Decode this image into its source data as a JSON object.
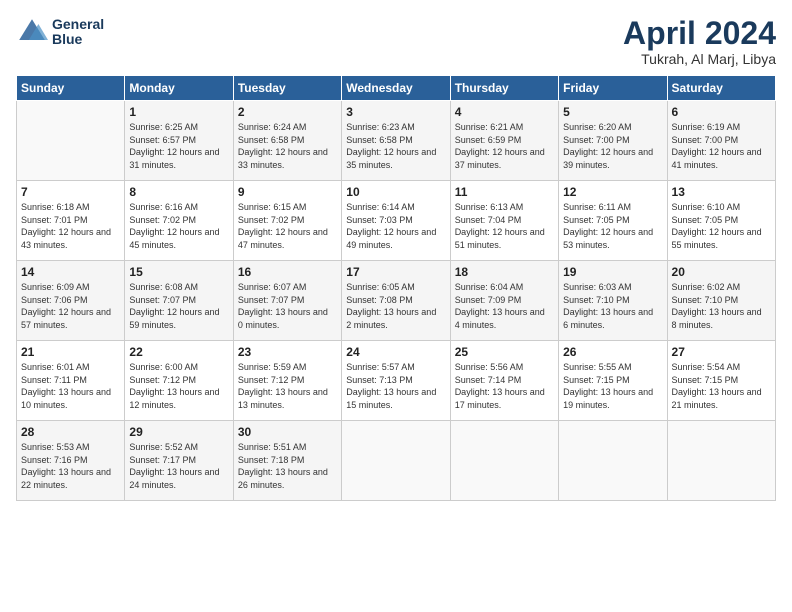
{
  "header": {
    "logo_line1": "General",
    "logo_line2": "Blue",
    "title": "April 2024",
    "location": "Tukrah, Al Marj, Libya"
  },
  "weekdays": [
    "Sunday",
    "Monday",
    "Tuesday",
    "Wednesday",
    "Thursday",
    "Friday",
    "Saturday"
  ],
  "weeks": [
    [
      {
        "day": "",
        "sunrise": "",
        "sunset": "",
        "daylight": ""
      },
      {
        "day": "1",
        "sunrise": "Sunrise: 6:25 AM",
        "sunset": "Sunset: 6:57 PM",
        "daylight": "Daylight: 12 hours and 31 minutes."
      },
      {
        "day": "2",
        "sunrise": "Sunrise: 6:24 AM",
        "sunset": "Sunset: 6:58 PM",
        "daylight": "Daylight: 12 hours and 33 minutes."
      },
      {
        "day": "3",
        "sunrise": "Sunrise: 6:23 AM",
        "sunset": "Sunset: 6:58 PM",
        "daylight": "Daylight: 12 hours and 35 minutes."
      },
      {
        "day": "4",
        "sunrise": "Sunrise: 6:21 AM",
        "sunset": "Sunset: 6:59 PM",
        "daylight": "Daylight: 12 hours and 37 minutes."
      },
      {
        "day": "5",
        "sunrise": "Sunrise: 6:20 AM",
        "sunset": "Sunset: 7:00 PM",
        "daylight": "Daylight: 12 hours and 39 minutes."
      },
      {
        "day": "6",
        "sunrise": "Sunrise: 6:19 AM",
        "sunset": "Sunset: 7:00 PM",
        "daylight": "Daylight: 12 hours and 41 minutes."
      }
    ],
    [
      {
        "day": "7",
        "sunrise": "Sunrise: 6:18 AM",
        "sunset": "Sunset: 7:01 PM",
        "daylight": "Daylight: 12 hours and 43 minutes."
      },
      {
        "day": "8",
        "sunrise": "Sunrise: 6:16 AM",
        "sunset": "Sunset: 7:02 PM",
        "daylight": "Daylight: 12 hours and 45 minutes."
      },
      {
        "day": "9",
        "sunrise": "Sunrise: 6:15 AM",
        "sunset": "Sunset: 7:02 PM",
        "daylight": "Daylight: 12 hours and 47 minutes."
      },
      {
        "day": "10",
        "sunrise": "Sunrise: 6:14 AM",
        "sunset": "Sunset: 7:03 PM",
        "daylight": "Daylight: 12 hours and 49 minutes."
      },
      {
        "day": "11",
        "sunrise": "Sunrise: 6:13 AM",
        "sunset": "Sunset: 7:04 PM",
        "daylight": "Daylight: 12 hours and 51 minutes."
      },
      {
        "day": "12",
        "sunrise": "Sunrise: 6:11 AM",
        "sunset": "Sunset: 7:05 PM",
        "daylight": "Daylight: 12 hours and 53 minutes."
      },
      {
        "day": "13",
        "sunrise": "Sunrise: 6:10 AM",
        "sunset": "Sunset: 7:05 PM",
        "daylight": "Daylight: 12 hours and 55 minutes."
      }
    ],
    [
      {
        "day": "14",
        "sunrise": "Sunrise: 6:09 AM",
        "sunset": "Sunset: 7:06 PM",
        "daylight": "Daylight: 12 hours and 57 minutes."
      },
      {
        "day": "15",
        "sunrise": "Sunrise: 6:08 AM",
        "sunset": "Sunset: 7:07 PM",
        "daylight": "Daylight: 12 hours and 59 minutes."
      },
      {
        "day": "16",
        "sunrise": "Sunrise: 6:07 AM",
        "sunset": "Sunset: 7:07 PM",
        "daylight": "Daylight: 13 hours and 0 minutes."
      },
      {
        "day": "17",
        "sunrise": "Sunrise: 6:05 AM",
        "sunset": "Sunset: 7:08 PM",
        "daylight": "Daylight: 13 hours and 2 minutes."
      },
      {
        "day": "18",
        "sunrise": "Sunrise: 6:04 AM",
        "sunset": "Sunset: 7:09 PM",
        "daylight": "Daylight: 13 hours and 4 minutes."
      },
      {
        "day": "19",
        "sunrise": "Sunrise: 6:03 AM",
        "sunset": "Sunset: 7:10 PM",
        "daylight": "Daylight: 13 hours and 6 minutes."
      },
      {
        "day": "20",
        "sunrise": "Sunrise: 6:02 AM",
        "sunset": "Sunset: 7:10 PM",
        "daylight": "Daylight: 13 hours and 8 minutes."
      }
    ],
    [
      {
        "day": "21",
        "sunrise": "Sunrise: 6:01 AM",
        "sunset": "Sunset: 7:11 PM",
        "daylight": "Daylight: 13 hours and 10 minutes."
      },
      {
        "day": "22",
        "sunrise": "Sunrise: 6:00 AM",
        "sunset": "Sunset: 7:12 PM",
        "daylight": "Daylight: 13 hours and 12 minutes."
      },
      {
        "day": "23",
        "sunrise": "Sunrise: 5:59 AM",
        "sunset": "Sunset: 7:12 PM",
        "daylight": "Daylight: 13 hours and 13 minutes."
      },
      {
        "day": "24",
        "sunrise": "Sunrise: 5:57 AM",
        "sunset": "Sunset: 7:13 PM",
        "daylight": "Daylight: 13 hours and 15 minutes."
      },
      {
        "day": "25",
        "sunrise": "Sunrise: 5:56 AM",
        "sunset": "Sunset: 7:14 PM",
        "daylight": "Daylight: 13 hours and 17 minutes."
      },
      {
        "day": "26",
        "sunrise": "Sunrise: 5:55 AM",
        "sunset": "Sunset: 7:15 PM",
        "daylight": "Daylight: 13 hours and 19 minutes."
      },
      {
        "day": "27",
        "sunrise": "Sunrise: 5:54 AM",
        "sunset": "Sunset: 7:15 PM",
        "daylight": "Daylight: 13 hours and 21 minutes."
      }
    ],
    [
      {
        "day": "28",
        "sunrise": "Sunrise: 5:53 AM",
        "sunset": "Sunset: 7:16 PM",
        "daylight": "Daylight: 13 hours and 22 minutes."
      },
      {
        "day": "29",
        "sunrise": "Sunrise: 5:52 AM",
        "sunset": "Sunset: 7:17 PM",
        "daylight": "Daylight: 13 hours and 24 minutes."
      },
      {
        "day": "30",
        "sunrise": "Sunrise: 5:51 AM",
        "sunset": "Sunset: 7:18 PM",
        "daylight": "Daylight: 13 hours and 26 minutes."
      },
      {
        "day": "",
        "sunrise": "",
        "sunset": "",
        "daylight": ""
      },
      {
        "day": "",
        "sunrise": "",
        "sunset": "",
        "daylight": ""
      },
      {
        "day": "",
        "sunrise": "",
        "sunset": "",
        "daylight": ""
      },
      {
        "day": "",
        "sunrise": "",
        "sunset": "",
        "daylight": ""
      }
    ]
  ]
}
